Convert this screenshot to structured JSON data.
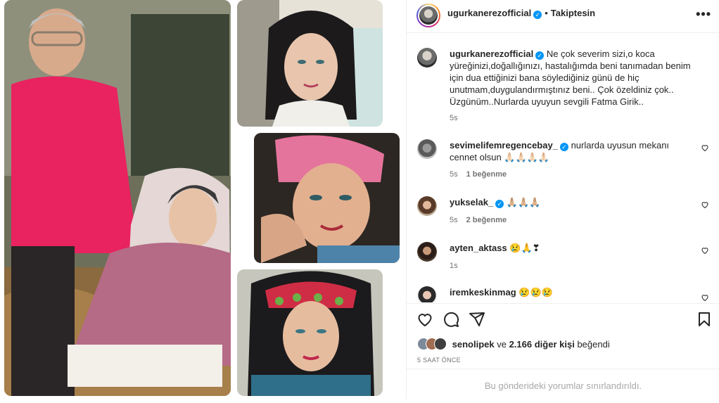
{
  "post": {
    "author": "ugurkanerezofficial",
    "follow_status": "Takiptesin",
    "caption": "Ne çok severim sizi,o koca yüreğinizi,doğallığınızı, hastalığımda beni tanımadan benim için dua ettiğinizi bana söylediğiniz günü de hiç unutmam,duygulandırmıştınız beni.. Çok özeldiniz çok.. Üzgünüm..Nurlarda uyuyun sevgili Fatma Girik..",
    "caption_time": "5s",
    "likes_prefix_user": "senolipek",
    "likes_connector": "ve",
    "likes_count_text": "2.166 diğer kişi",
    "likes_suffix": "beğendi",
    "posted_ago": "5 SAAT ÖNCE",
    "comments_restricted": "Bu gönderideki yorumlar sınırlandırıldı."
  },
  "comments": [
    {
      "user": "sevimelifemregencebay_",
      "verified": true,
      "text": "nurlarda uyusun mekanı cennet olsun 🙏🏻🙏🏻🙏🏻🙏🏻",
      "time": "5s",
      "likes": "1 beğenme"
    },
    {
      "user": "yukselak_",
      "verified": true,
      "text": "🙏🏼🙏🏼🙏🏼",
      "time": "5s",
      "likes": "2 beğenme"
    },
    {
      "user": "ayten_aktass",
      "verified": false,
      "text": "😢🙏❣",
      "time": "1s",
      "likes": ""
    },
    {
      "user": "iremkeskinmag",
      "verified": false,
      "text": "😢😢😢",
      "time": "",
      "likes": ""
    }
  ],
  "icons": {
    "more": "more-options-icon",
    "verified": "verified-badge-icon",
    "like": "heart-icon",
    "comment": "comment-icon",
    "share": "share-icon",
    "save": "bookmark-icon"
  },
  "colors": {
    "verified": "#0095f6",
    "text": "#262626",
    "muted": "#737373",
    "divider": "#efefef"
  }
}
